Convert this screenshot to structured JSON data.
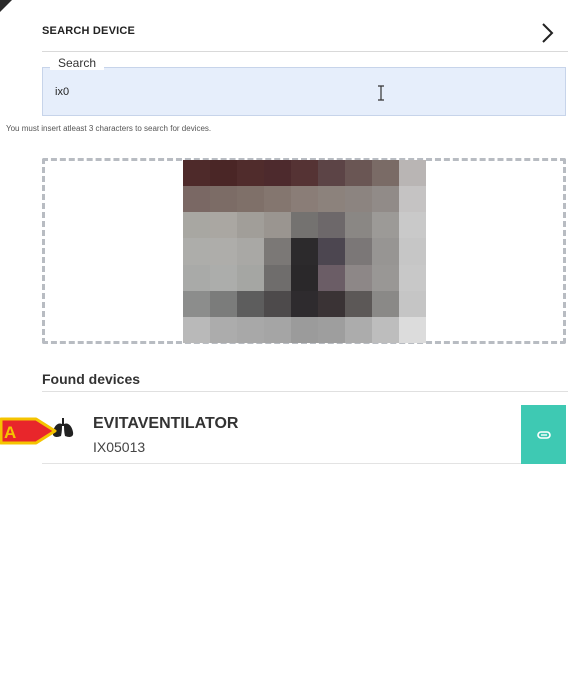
{
  "header": {
    "title": "SEARCH DEVICE",
    "icon": "chevron-right-icon"
  },
  "search": {
    "label": "Search",
    "value": "ix0",
    "hint": "You must insert atleast 3 characters to search for devices."
  },
  "found": {
    "title": "Found devices",
    "devices": [
      {
        "name": "EVITAVENTILATOR",
        "id": "IX05013",
        "icon": "lungs-icon",
        "action_icon": "link-icon"
      }
    ]
  },
  "callout": {
    "label": "A"
  },
  "colors": {
    "accent": "#3ec9b3",
    "search_bg": "#e6eefb",
    "callout_fill": "#e8262b",
    "callout_stroke": "#f5c400"
  }
}
